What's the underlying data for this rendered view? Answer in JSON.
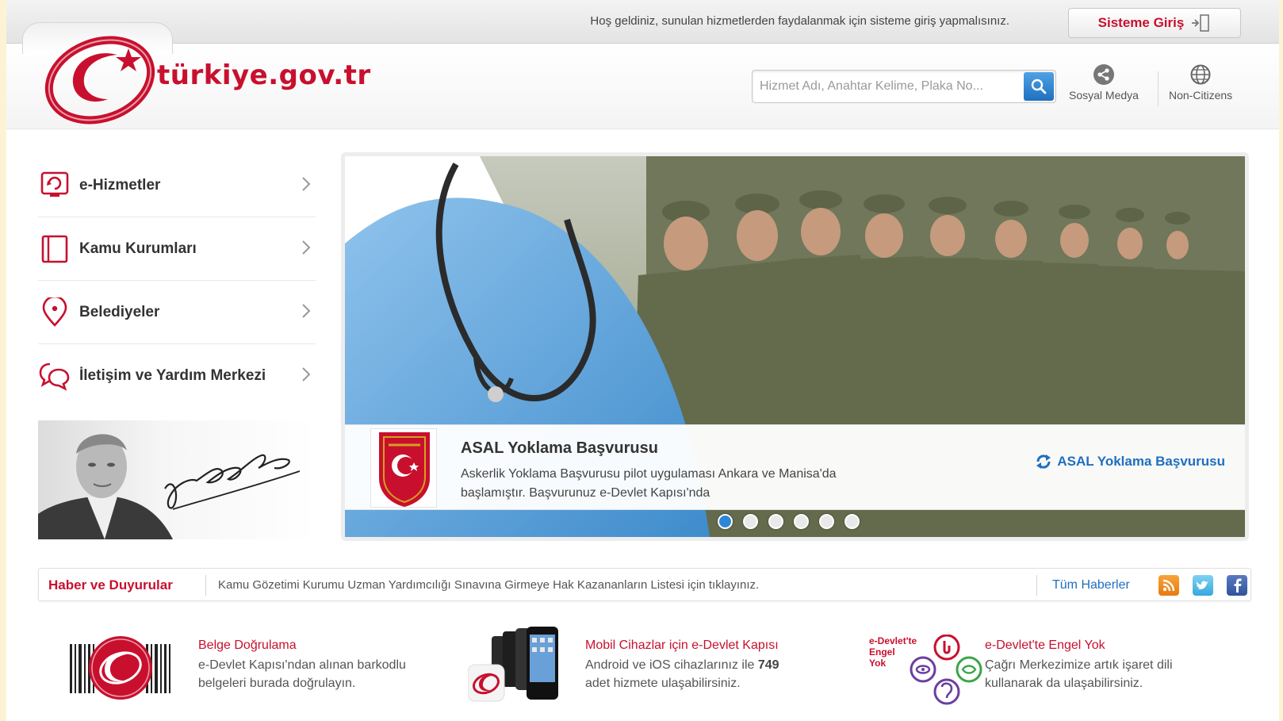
{
  "topbar": {
    "welcome": "Hoş geldiniz, sunulan hizmetlerden faydalanmak için sisteme giriş yapmalısınız.",
    "login_label": "Sisteme Giriş"
  },
  "header": {
    "logo_text": "türkiye.gov.tr",
    "search_placeholder": "Hizmet Adı, Anahtar Kelime, Plaka No...",
    "social_label": "Sosyal Medya",
    "noncitizens_label": "Non-Citizens"
  },
  "menu": {
    "items": [
      {
        "label": "e-Hizmetler",
        "icon": "e-services-icon"
      },
      {
        "label": "Kamu Kurumları",
        "icon": "institutions-icon"
      },
      {
        "label": "Belediyeler",
        "icon": "location-pin-icon"
      },
      {
        "label": "İletişim ve Yardım Merkezi",
        "icon": "chat-bubbles-icon"
      }
    ]
  },
  "slider": {
    "title": "ASAL Yoklama Başvurusu",
    "description": "Askerlik Yoklama Başvurusu pilot uygulaması Ankara ve Manisa'da başlamıştır. Başvurunuz e-Devlet Kapısı'nda",
    "link_label": "ASAL Yoklama Başvurusu",
    "dots_count": 6,
    "active_dot": 1
  },
  "news": {
    "title": "Haber ve Duyurular",
    "text": "Kamu Gözetimi Kurumu Uzman Yardımcılığı Sınavına Girmeye Hak Kazananların Listesi için tıklayınız.",
    "all_label": "Tüm Haberler"
  },
  "features": [
    {
      "title": "Belge Doğrulama",
      "line1": "e-Devlet Kapısı'ndan alınan barkodlu",
      "line2": "belgeleri burada doğrulayın."
    },
    {
      "title": "Mobil Cihazlar için e-Devlet Kapısı",
      "line1_pre": "Android ve iOS cihazlarınız ile ",
      "line1_num": "749",
      "line2": "adet hizmete ulaşabilirsiniz."
    },
    {
      "title": "e-Devlet'te Engel Yok",
      "line1": "Çağrı Merkezimize artık işaret dili",
      "line2": "kullanarak da ulaşabilirsiniz.",
      "logo_text": "e-Devlet'te Engel Yok"
    }
  ],
  "colors": {
    "brand_red": "#c8102e",
    "link_blue": "#1f6fbf",
    "page_bg": "#fbf4d4"
  }
}
